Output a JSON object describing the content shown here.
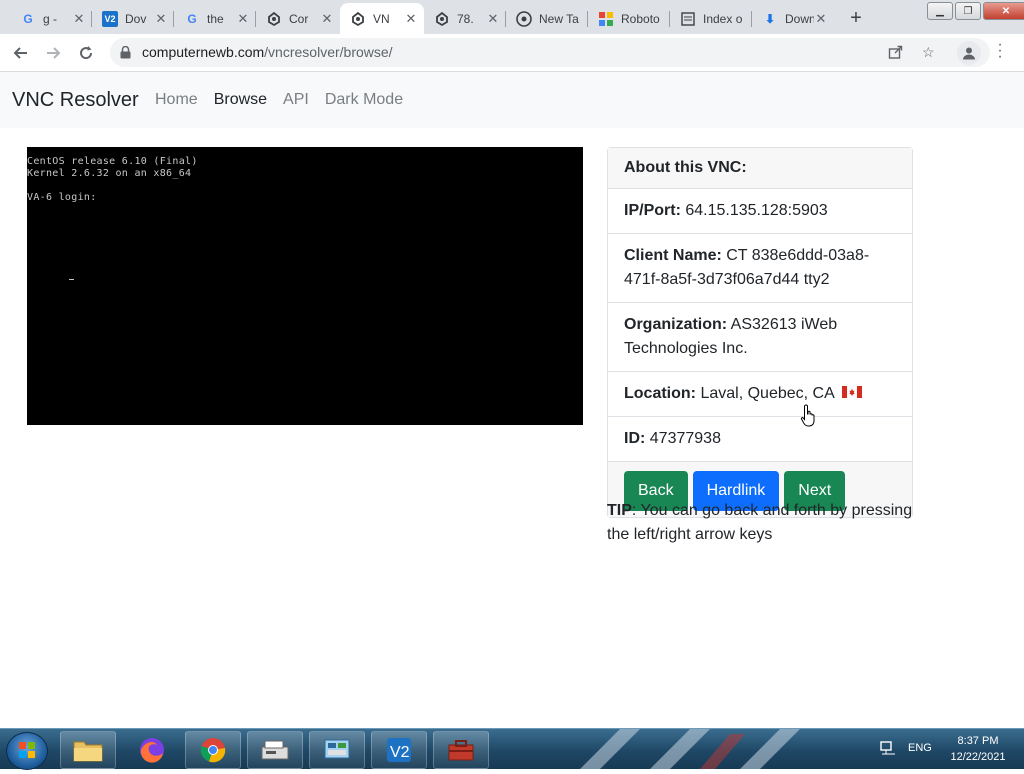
{
  "browser": {
    "tabs": [
      {
        "title": "g -",
        "icon": "google-icon",
        "active": false
      },
      {
        "title": "Dov",
        "icon": "vnc-logo-icon",
        "active": false
      },
      {
        "title": "the",
        "icon": "google-icon",
        "active": false
      },
      {
        "title": "Cor",
        "icon": "vnc-resolver-icon",
        "active": false
      },
      {
        "title": "VN",
        "icon": "vnc-resolver-icon",
        "active": true
      },
      {
        "title": "78.",
        "icon": "vnc-resolver-icon",
        "active": false
      },
      {
        "title": "New Ta",
        "icon": "chrome-icon",
        "active": false
      },
      {
        "title": "Roboto",
        "icon": "colorful-grid-icon",
        "active": false
      },
      {
        "title": "Index o",
        "icon": "document-icon",
        "active": false
      },
      {
        "title": "Downlo",
        "icon": "download-icon",
        "active": false
      }
    ],
    "url_host": "computernewb.com",
    "url_path": "/vncresolver/browse/"
  },
  "site": {
    "brand": "VNC Resolver",
    "nav": [
      {
        "label": "Home",
        "active": false
      },
      {
        "label": "Browse",
        "active": true
      },
      {
        "label": "API",
        "active": false
      },
      {
        "label": "Dark Mode",
        "active": false
      }
    ]
  },
  "screenshot": {
    "lines": [
      "CentOS release 6.10 (Final)",
      "Kernel 2.6.32 on an x86_64",
      "",
      "VA-6 login:"
    ]
  },
  "info": {
    "header": "About this VNC:",
    "ipport_label": "IP/Port:",
    "ipport_value": "64.15.135.128:5903",
    "client_label": "Client Name:",
    "client_value": "CT 838e6ddd-03a8-471f-8a5f-3d73f06a7d44 tty2",
    "org_label": "Organization:",
    "org_value": "AS32613 iWeb Technologies Inc.",
    "location_label": "Location:",
    "location_value": "Laval, Quebec, CA",
    "location_flag": "canada-flag-icon",
    "id_label": "ID:",
    "id_value": "47377938",
    "buttons": {
      "back": "Back",
      "hardlink": "Hardlink",
      "next": "Next"
    },
    "colors": {
      "green": "#198754",
      "blue": "#0d6efd"
    }
  },
  "tip": {
    "label": "TIP",
    "text": ": You can go back and forth by pressing the left/right arrow keys"
  },
  "taskbar": {
    "apps": [
      "file-explorer-icon",
      "firefox-icon",
      "chrome-icon",
      "scanner-icon",
      "control-panel-icon",
      "vnc-viewer-icon",
      "toolbox-icon"
    ],
    "lang": "ENG",
    "time": "8:37 PM",
    "date": "12/22/2021"
  }
}
